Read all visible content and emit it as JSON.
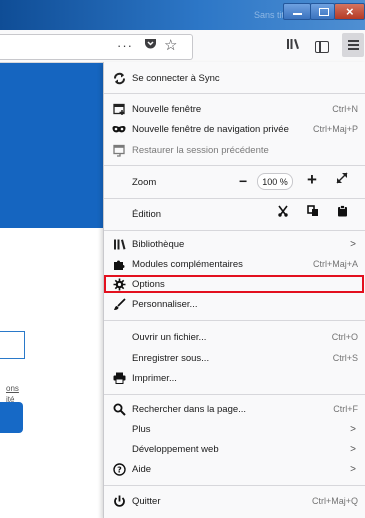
{
  "window": {
    "title": "Sans titre"
  },
  "toolbar": {
    "more_icon": "···",
    "pocket_icon": "pocket-icon",
    "bookmark_icon": "☆",
    "library_icon": "library-icon",
    "sidebar_icon": "sidebar-icon",
    "menu_icon": "hamburger-icon"
  },
  "page": {
    "link1": "ons",
    "link2": "ité"
  },
  "menu": {
    "sync": "Se connecter à Sync",
    "new_window": {
      "label": "Nouvelle fenêtre",
      "shortcut": "Ctrl+N"
    },
    "private_window": {
      "label": "Nouvelle fenêtre de navigation privée",
      "shortcut": "Ctrl+Maj+P"
    },
    "restore": "Restaurer la session précédente",
    "zoom": {
      "label": "Zoom",
      "minus": "−",
      "value": "100 %",
      "plus": "+"
    },
    "edit": {
      "label": "Édition"
    },
    "library": {
      "label": "Bibliothèque"
    },
    "addons": {
      "label": "Modules complémentaires",
      "shortcut": "Ctrl+Maj+A"
    },
    "options": {
      "label": "Options"
    },
    "customize": {
      "label": "Personnaliser..."
    },
    "open_file": {
      "label": "Ouvrir un fichier...",
      "shortcut": "Ctrl+O"
    },
    "save_as": {
      "label": "Enregistrer sous...",
      "shortcut": "Ctrl+S"
    },
    "print": {
      "label": "Imprimer..."
    },
    "find": {
      "label": "Rechercher dans la page...",
      "shortcut": "Ctrl+F"
    },
    "more": {
      "label": "Plus"
    },
    "web_dev": {
      "label": "Développement web"
    },
    "help": {
      "label": "Aide"
    },
    "quit": {
      "label": "Quitter",
      "shortcut": "Ctrl+Maj+Q"
    }
  },
  "colors": {
    "highlight": "#e3101e",
    "page_blue": "#1565c0"
  }
}
